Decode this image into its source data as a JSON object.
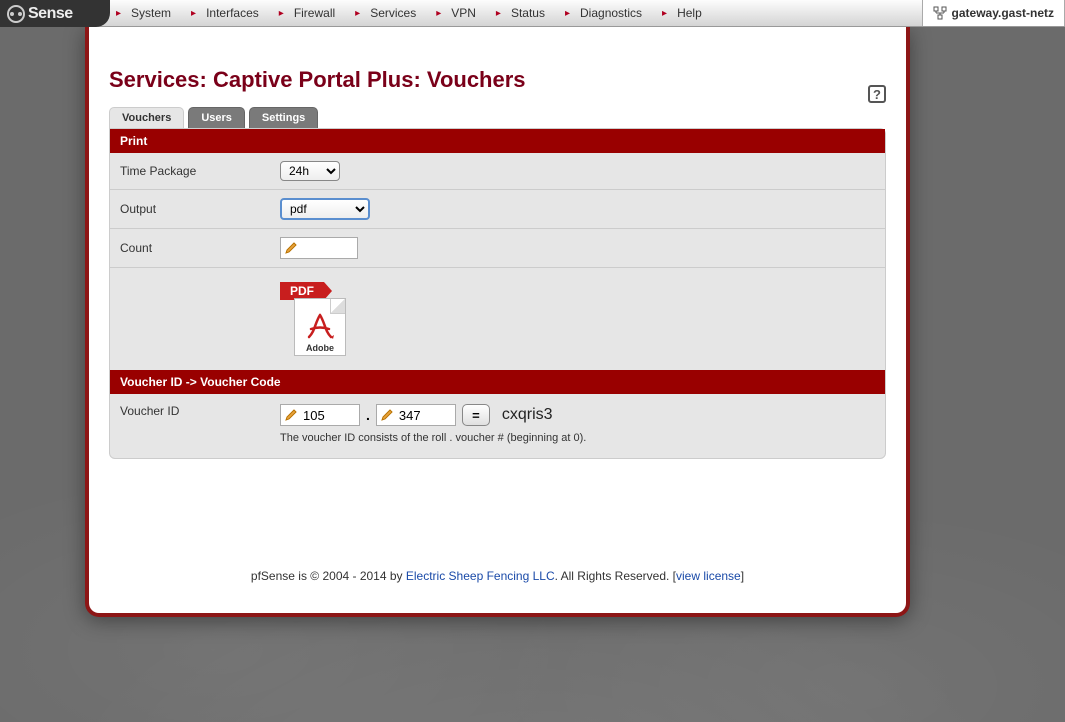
{
  "logo": "Sense",
  "nav": [
    "System",
    "Interfaces",
    "Firewall",
    "Services",
    "VPN",
    "Status",
    "Diagnostics",
    "Help"
  ],
  "hostname": "gateway.gast-netz",
  "page_title": "Services: Captive Portal Plus: Vouchers",
  "tabs": {
    "vouchers": "Vouchers",
    "users": "Users",
    "settings": "Settings"
  },
  "print": {
    "heading": "Print",
    "time_label": "Time Package",
    "time_value": "24h",
    "output_label": "Output",
    "output_value": "pdf",
    "count_label": "Count",
    "count_value": "",
    "pdf_badge": "PDF",
    "adobe_label": "Adobe"
  },
  "voucher": {
    "heading": "Voucher ID -> Voucher Code",
    "label": "Voucher ID",
    "roll": "105",
    "num": "347",
    "eq": "=",
    "code": "cxqris3",
    "hint": "The voucher ID consists of the roll . voucher # (beginning at 0)."
  },
  "footer": {
    "pre": "pfSense is © 2004 - 2014 by ",
    "link1": "Electric Sheep Fencing LLC",
    "mid": ". All Rights Reserved. [",
    "link2": "view license",
    "post": "]"
  }
}
